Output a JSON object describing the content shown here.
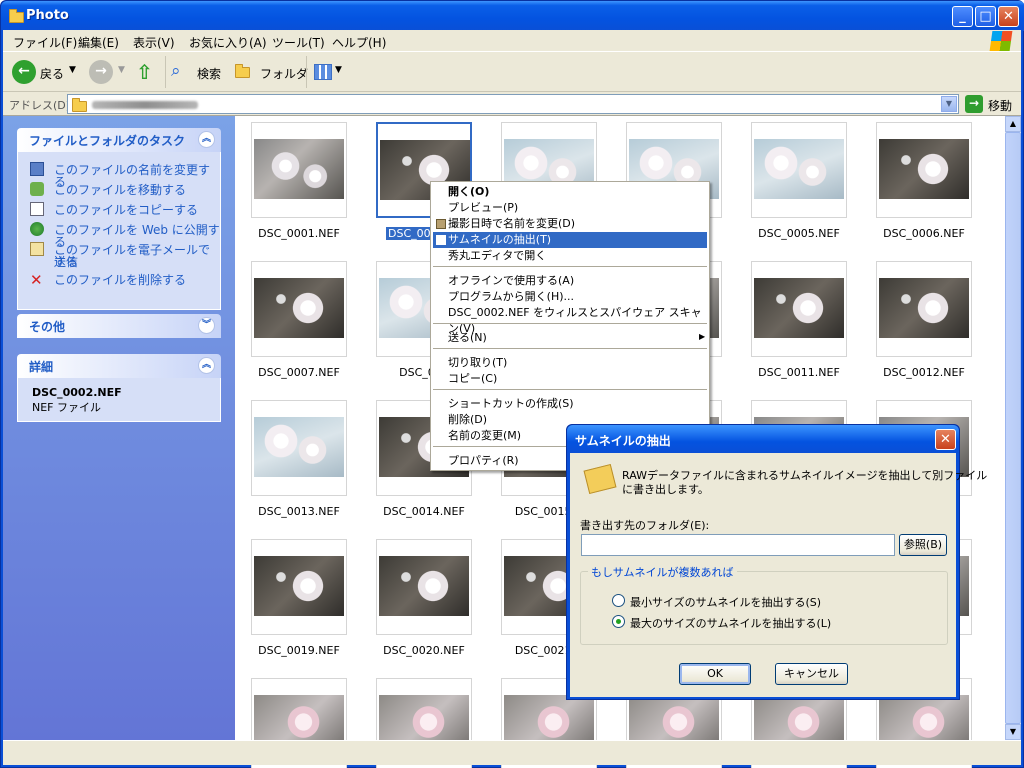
{
  "window": {
    "title": "Photo"
  },
  "menubar": [
    "ファイル(F)",
    "編集(E)",
    "表示(V)",
    "お気に入り(A)",
    "ツール(T)",
    "ヘルプ(H)"
  ],
  "toolbar": {
    "back": "戻る",
    "search": "検索",
    "folders": "フォルダ"
  },
  "address": {
    "label": "アドレス(D)",
    "go": "移動"
  },
  "sidebar": {
    "tasks_title": "ファイルとフォルダのタスク",
    "tasks": [
      "このファイルの名前を変更する",
      "このファイルを移動する",
      "このファイルをコピーする",
      "このファイルを Web に公開する",
      "このファイルを電子メールで送信",
      "する",
      "このファイルを削除する"
    ],
    "other_title": "その他",
    "details_title": "詳細",
    "details_name": "DSC_0002.NEF",
    "details_type": "NEF ファイル"
  },
  "files": [
    "DSC_0001.NEF",
    "DSC_000",
    "",
    "",
    "DSC_0005.NEF",
    "DSC_0006.NEF",
    "DSC_0007.NEF",
    "DSC_000",
    "",
    "",
    "DSC_0011.NEF",
    "DSC_0012.NEF",
    "DSC_0013.NEF",
    "DSC_0014.NEF",
    "DSC_0015.N",
    "",
    "",
    "",
    "DSC_0019.NEF",
    "DSC_0020.NEF",
    "DSC_0021.N",
    "",
    "",
    ""
  ],
  "context_menu": [
    "開く(O)",
    "プレビュー(P)",
    "撮影日時で名前を変更(D)",
    "サムネイルの抽出(T)",
    "秀丸エディタで開く",
    "オフラインで使用する(A)",
    "プログラムから開く(H)...",
    "DSC_0002.NEF をウィルスとスパイウェア スキャン(V)",
    "送る(N)",
    "切り取り(T)",
    "コピー(C)",
    "ショートカットの作成(S)",
    "削除(D)",
    "名前の変更(M)",
    "プロパティ(R)"
  ],
  "dialog": {
    "title": "サムネイルの抽出",
    "desc1": "RAWデータファイルに含まれるサムネイルイメージを抽出して別ファイル",
    "desc2": "に書き出します。",
    "folder_label": "書き出す先のフォルダ(E):",
    "folder_value": "",
    "browse": "参照(B)",
    "group": "もしサムネイルが複数あれば",
    "opt_min": "最小サイズのサムネイルを抽出する(S)",
    "opt_max": "最大のサイズのサムネイルを抽出する(L)",
    "ok": "OK",
    "cancel": "キャンセル"
  }
}
